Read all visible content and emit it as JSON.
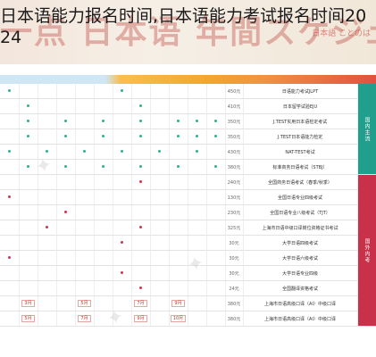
{
  "page": {
    "title": "日本语能力报名时间,日本语能力考试报名时间2024"
  },
  "banner": {
    "background_text": "一点 日本语 年間スケジュール 日语考试",
    "logo_text": "日本語 ことのは"
  },
  "schedule": {
    "month_columns": 12,
    "groups": [
      {
        "label": "国内主流",
        "color": "#1f9f8c"
      },
      {
        "label": "国外内考",
        "color": "#c9304a"
      }
    ],
    "rows": [
      {
        "name": "日语能力考试JLPT",
        "fee": "450元",
        "marks": [
          0,
          6
        ],
        "group": 0
      },
      {
        "name": "日本留学试验EJU",
        "fee": "410元",
        "marks": [
          1,
          7
        ],
        "group": 0
      },
      {
        "name": "J.TEST实用日本语检定考试",
        "fee": "350元",
        "marks": [
          1,
          3,
          5,
          7,
          9,
          10,
          11
        ],
        "group": 0
      },
      {
        "name": "J.TEST日本语能力检定",
        "fee": "350元",
        "marks": [
          1,
          3,
          5,
          7,
          9,
          10,
          11
        ],
        "group": 0
      },
      {
        "name": "NAT-TEST考试",
        "fee": "430元",
        "marks": [
          0,
          2,
          4,
          6,
          8,
          10
        ],
        "group": 0
      },
      {
        "name": "标准商务日语考试（STBJ）",
        "fee": "380元",
        "marks": [
          1,
          3,
          5,
          7,
          9,
          11
        ],
        "group": 0
      },
      {
        "name": "全国商务日语考试（春季/秋季）",
        "fee": "240元",
        "marks": [
          7
        ],
        "group": 1
      },
      {
        "name": "全国日语专业四级考试",
        "fee": "130元",
        "marks": [
          0
        ],
        "group": 1
      },
      {
        "name": "全国日语专业八级考试（TJT）",
        "fee": "230元",
        "marks": [
          3
        ],
        "group": 1
      },
      {
        "name": "上海市日语中级口译岗位资格证书考试",
        "fee": "325元",
        "marks": [
          2,
          7
        ],
        "group": 1
      },
      {
        "name": "大学日语四级考试",
        "fee": "30元",
        "marks": [
          6
        ],
        "group": 1
      },
      {
        "name": "大学日语六级考试",
        "fee": "30元",
        "marks": [
          0
        ],
        "group": 1
      },
      {
        "name": "大学日语专业四级",
        "fee": "30元",
        "marks": [
          6
        ],
        "group": 1
      },
      {
        "name": "全国翻译资格考试",
        "fee": "24元",
        "marks": [
          7
        ],
        "group": 1
      },
      {
        "name": "上海市日语高级口译（AI）中级口译",
        "fee": "380元",
        "marks": [],
        "group": 1
      },
      {
        "name": "上海市日语高级口译（AI）中级口译",
        "fee": "380元",
        "marks": [],
        "group": 1
      }
    ],
    "special_row_tags": [
      "3月",
      "5月",
      "7月",
      "9月",
      "10月"
    ]
  }
}
